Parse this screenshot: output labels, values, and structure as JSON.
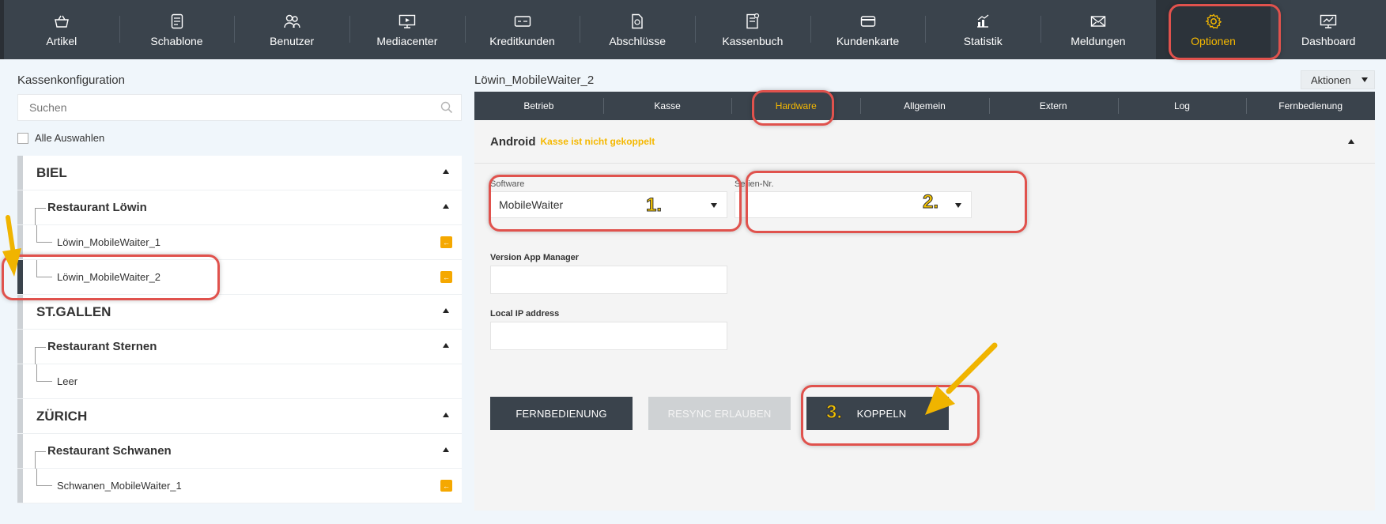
{
  "nav": {
    "items": [
      {
        "label": "Artikel",
        "icon": "basket-icon"
      },
      {
        "label": "Schablone",
        "icon": "template-icon"
      },
      {
        "label": "Benutzer",
        "icon": "users-icon"
      },
      {
        "label": "Mediacenter",
        "icon": "monitor-icon"
      },
      {
        "label": "Kreditkunden",
        "icon": "credit-card-icon"
      },
      {
        "label": "Abschlüsse",
        "icon": "report-icon"
      },
      {
        "label": "Kassenbuch",
        "icon": "cashbook-icon"
      },
      {
        "label": "Kundenkarte",
        "icon": "card-icon"
      },
      {
        "label": "Statistik",
        "icon": "chart-icon"
      },
      {
        "label": "Meldungen",
        "icon": "envelope-icon"
      },
      {
        "label": "Optionen",
        "icon": "gear-icon"
      },
      {
        "label": "Dashboard",
        "icon": "dashboard-icon"
      }
    ],
    "active_color": "#f5b800"
  },
  "left": {
    "title": "Kassenkonfiguration",
    "search_placeholder": "Suchen",
    "select_all": "Alle Auswahlen",
    "tree": {
      "biel": "BIEL",
      "restaurant_loewin": "Restaurant Löwin",
      "mw1": "Löwin_MobileWaiter_1",
      "mw2": "Löwin_MobileWaiter_2",
      "stgallen": "ST.GALLEN",
      "restaurant_sternen": "Restaurant Sternen",
      "leer": "Leer",
      "zuerich": "ZÜRICH",
      "restaurant_schwanen": "Restaurant Schwanen",
      "schwanen_mw1": "Schwanen_MobileWaiter_1"
    }
  },
  "right": {
    "title": "Löwin_MobileWaiter_2",
    "actions_label": "Aktionen",
    "tabs": [
      "Betrieb",
      "Kasse",
      "Hardware",
      "Allgemein",
      "Extern",
      "Log",
      "Fernbedienung"
    ],
    "section_title": "Android",
    "section_status": "Kasse ist nicht gekoppelt",
    "software_label": "Software",
    "software_value": "MobileWaiter",
    "serial_label": "Serien-Nr.",
    "serial_value": "",
    "version_label": "Version App Manager",
    "ip_label": "Local IP address",
    "btn_remote": "FERNBEDIENUNG",
    "btn_resync": "RESYNC ERLAUBEN",
    "btn_couple": "KOPPELN"
  },
  "annotations": {
    "step1": "1.",
    "step2": "2.",
    "step3": "3.",
    "highlight_color": "#e0524d",
    "arrow_color": "#f0b400"
  }
}
